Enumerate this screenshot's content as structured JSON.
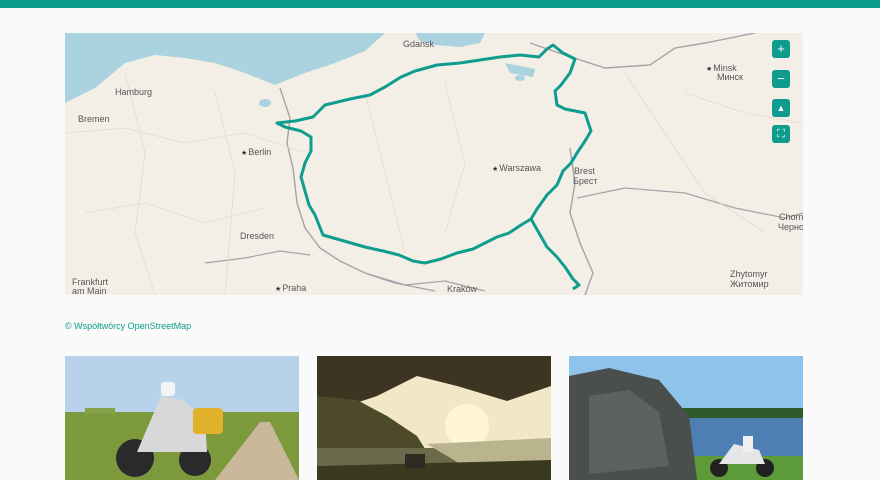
{
  "map": {
    "cities": [
      {
        "name": "Gdansk",
        "dot": false
      },
      {
        "name": "Minsk",
        "dot": true
      },
      {
        "name": "Минск",
        "dot": false
      },
      {
        "name": "Hamburg",
        "dot": false
      },
      {
        "name": "Bremen",
        "dot": false
      },
      {
        "name": "Berlin",
        "dot": true
      },
      {
        "name": "Warszawa",
        "dot": true
      },
      {
        "name": "Brest",
        "dot": false
      },
      {
        "name": "Брест",
        "dot": false
      },
      {
        "name": "Dresden",
        "dot": false
      },
      {
        "name": "Frankfurt",
        "dot": false
      },
      {
        "name": "am Main",
        "dot": false
      },
      {
        "name": "Praha",
        "dot": true
      },
      {
        "name": "Kraków",
        "dot": false
      },
      {
        "name": "Zhytomyr",
        "dot": false
      },
      {
        "name": "Житомир",
        "dot": false
      },
      {
        "name": "Chorn",
        "dot": false
      },
      {
        "name": "Черно",
        "dot": false
      }
    ],
    "controls": {
      "zoom_in": "+",
      "zoom_out": "−",
      "compass": "▲",
      "fullscreen": "⛶"
    },
    "route_color": "#0e9c8e",
    "water_color": "#aad3df",
    "land_color": "#f3efe7"
  },
  "attribution": "© Współtwórcy OpenStreetMap",
  "photos": [
    {
      "subject": "motorcycle-on-dirt-road"
    },
    {
      "subject": "sunset-over-lake"
    },
    {
      "subject": "rock-and-lake-with-motorcycle"
    }
  ]
}
